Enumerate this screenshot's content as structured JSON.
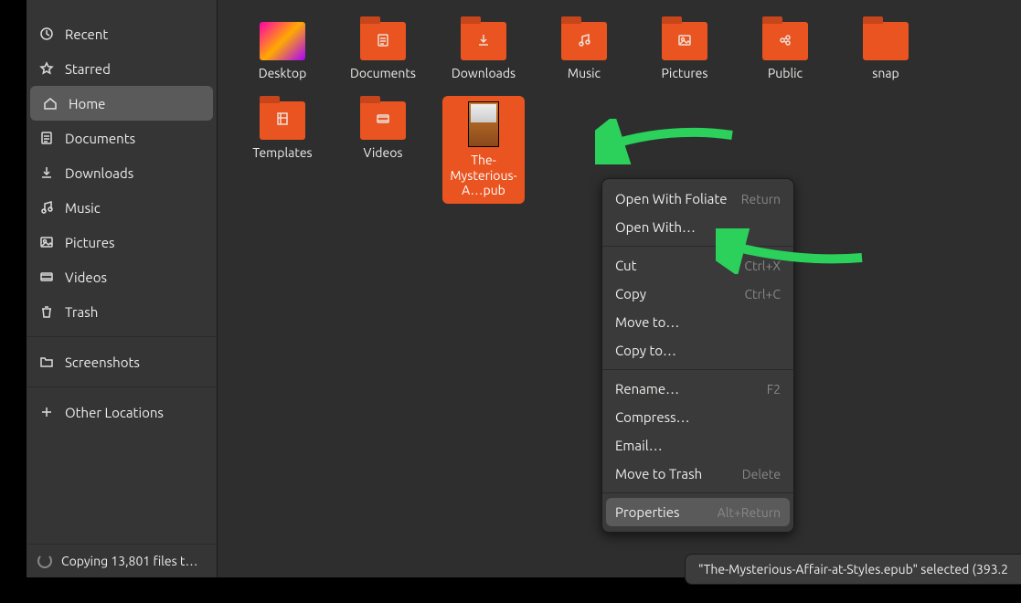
{
  "sidebar": {
    "items": [
      {
        "label": "Recent",
        "icon": "clock"
      },
      {
        "label": "Starred",
        "icon": "star"
      },
      {
        "label": "Home",
        "icon": "home",
        "active": true
      },
      {
        "label": "Documents",
        "icon": "doc"
      },
      {
        "label": "Downloads",
        "icon": "download"
      },
      {
        "label": "Music",
        "icon": "music"
      },
      {
        "label": "Pictures",
        "icon": "picture"
      },
      {
        "label": "Videos",
        "icon": "video"
      },
      {
        "label": "Trash",
        "icon": "trash"
      }
    ],
    "screenshots": "Screenshots",
    "other": "Other Locations",
    "status": "Copying 13,801 files t…"
  },
  "files": [
    {
      "label": "Desktop",
      "type": "desktop"
    },
    {
      "label": "Documents",
      "type": "folder",
      "glyph": "doc"
    },
    {
      "label": "Downloads",
      "type": "folder",
      "glyph": "download"
    },
    {
      "label": "Music",
      "type": "folder",
      "glyph": "music"
    },
    {
      "label": "Pictures",
      "type": "folder",
      "glyph": "picture"
    },
    {
      "label": "Public",
      "type": "folder",
      "glyph": "share"
    },
    {
      "label": "snap",
      "type": "folder",
      "glyph": ""
    },
    {
      "label": "Templates",
      "type": "folder",
      "glyph": "template"
    },
    {
      "label": "Videos",
      "type": "folder",
      "glyph": "video"
    },
    {
      "label": "The-Mysterious-A…pub",
      "type": "epub",
      "selected": true
    }
  ],
  "context_menu": [
    {
      "label": "Open With Foliate",
      "shortcut": "Return"
    },
    {
      "label": "Open With…"
    },
    {
      "sep": true
    },
    {
      "label": "Cut",
      "shortcut": "Ctrl+X"
    },
    {
      "label": "Copy",
      "shortcut": "Ctrl+C"
    },
    {
      "label": "Move to…"
    },
    {
      "label": "Copy to…"
    },
    {
      "sep": true
    },
    {
      "label": "Rename…",
      "shortcut": "F2"
    },
    {
      "label": "Compress…"
    },
    {
      "label": "Email…"
    },
    {
      "label": "Move to Trash",
      "shortcut": "Delete"
    },
    {
      "sep": true
    },
    {
      "label": "Properties",
      "shortcut": "Alt+Return",
      "hover": true
    }
  ],
  "status_text": "\"The-Mysterious-Affair-at-Styles.epub\" selected  (393.2"
}
